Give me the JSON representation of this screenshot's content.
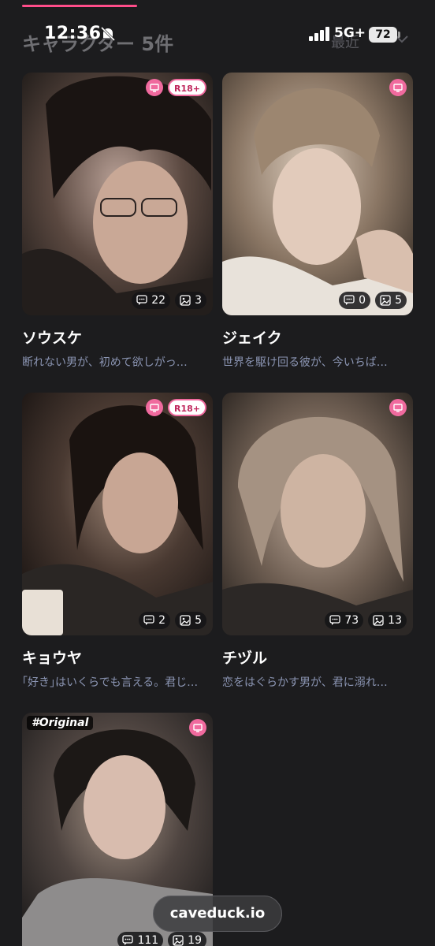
{
  "status_bar": {
    "time": "12:36",
    "network": "5G+",
    "battery": "72"
  },
  "header": {
    "title": "キャラクター 5件",
    "sort": "最近"
  },
  "icons": {
    "chat": "chat-bubble-icon",
    "image": "image-icon",
    "tv": "tv-icon",
    "accent": "#f06a9e"
  },
  "cards": [
    {
      "name": "ソウスケ",
      "desc": "断れない男が、初めて欲しがっ…",
      "r18": "R18+",
      "chats": "22",
      "images": "3"
    },
    {
      "name": "ジェイク",
      "desc": "世界を駆け回る彼が、今いちば…",
      "chats": "0",
      "images": "5"
    },
    {
      "name": "キョウヤ",
      "desc": "｢好き｣はいくらでも言える。君じ…",
      "r18": "R18+",
      "chats": "2",
      "images": "5"
    },
    {
      "name": "チヅル",
      "desc": "恋をはぐらかす男が、君に溺れ…",
      "chats": "73",
      "images": "13"
    },
    {
      "tag": "#Original",
      "chats": "111",
      "images": "19"
    }
  ],
  "watermark": "caveduck.io"
}
